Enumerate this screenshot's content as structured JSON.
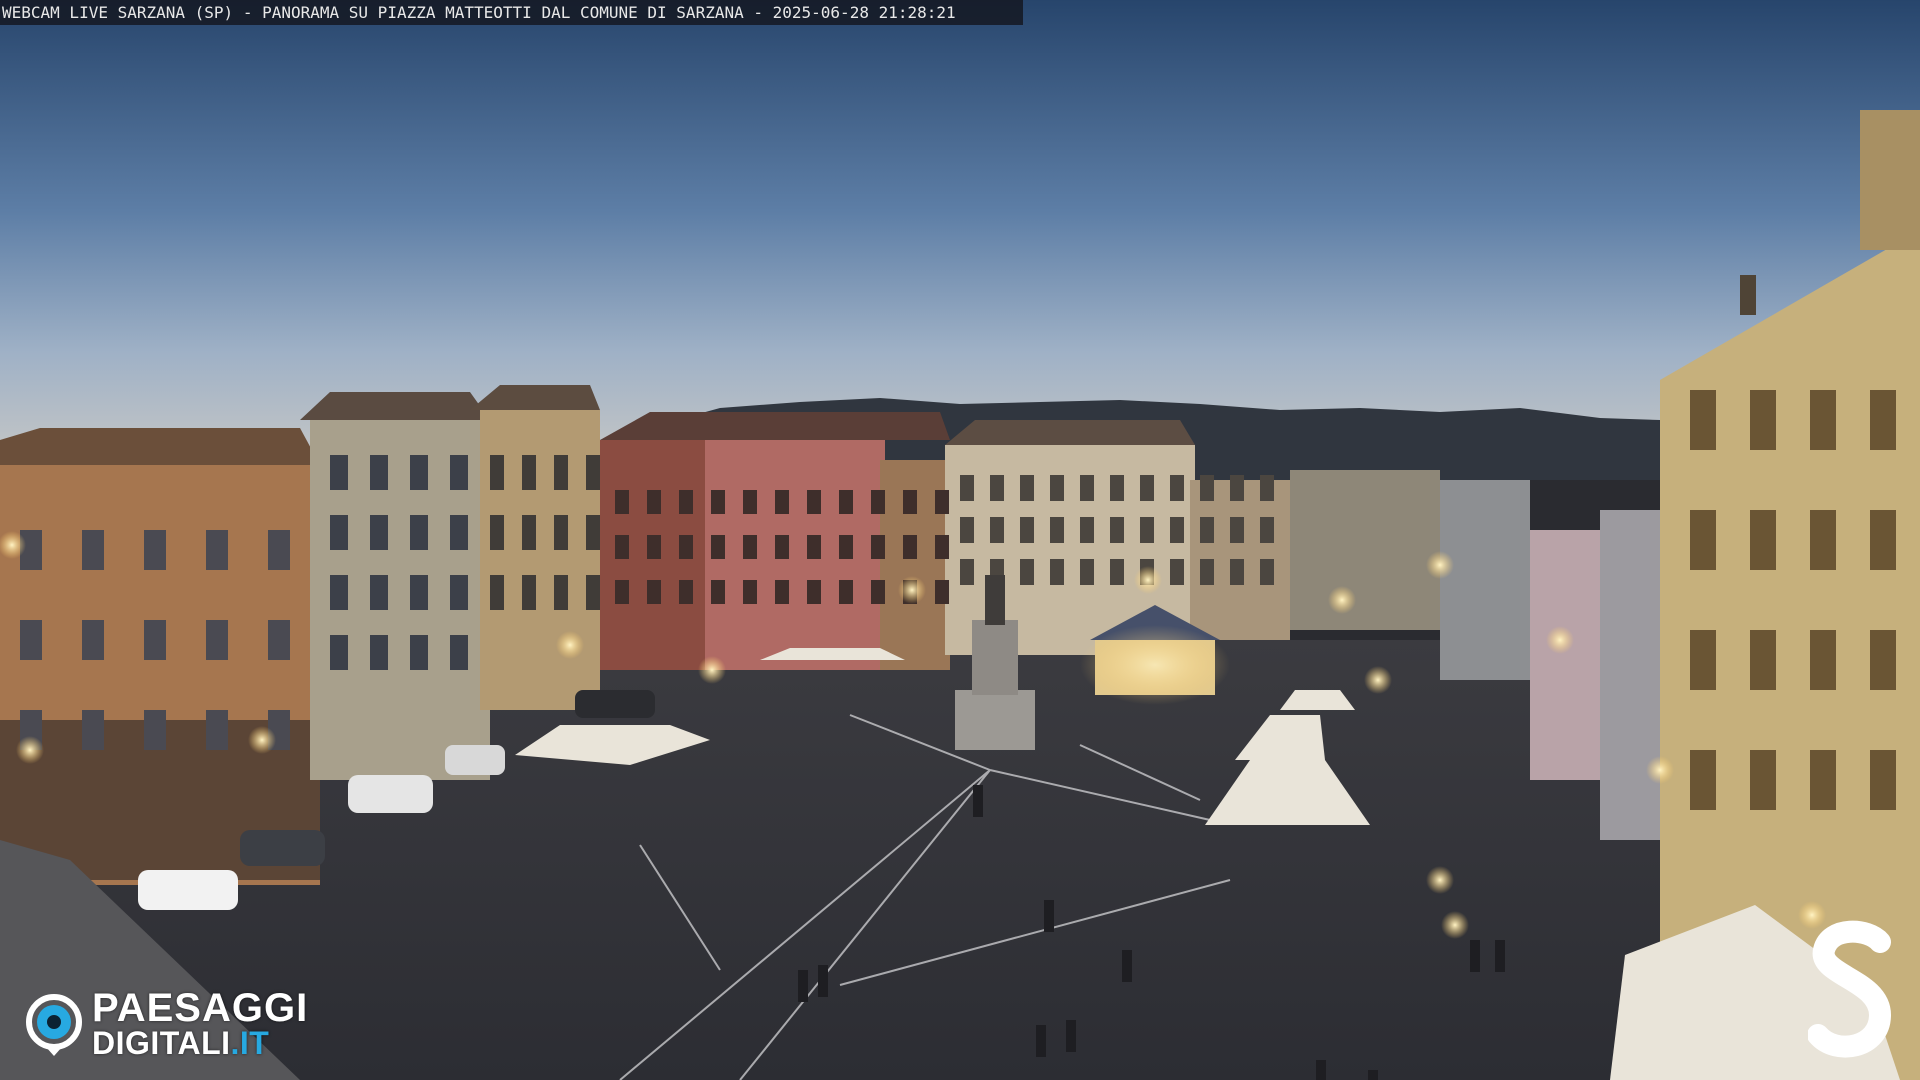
{
  "overlay": {
    "caption": "WEBCAM LIVE SARZANA (SP) - PANORAMA SU PIAZZA MATTEOTTI DAL COMUNE DI SARZANA - 2025-06-28  21:28:21"
  },
  "logo": {
    "line1": "PAESAGGI",
    "line2_main": "DIGITALI",
    "line2_tld": ".IT",
    "accent_color": "#27a9e1"
  },
  "corner_mark": {
    "letter": "S",
    "color": "#ffffff"
  }
}
